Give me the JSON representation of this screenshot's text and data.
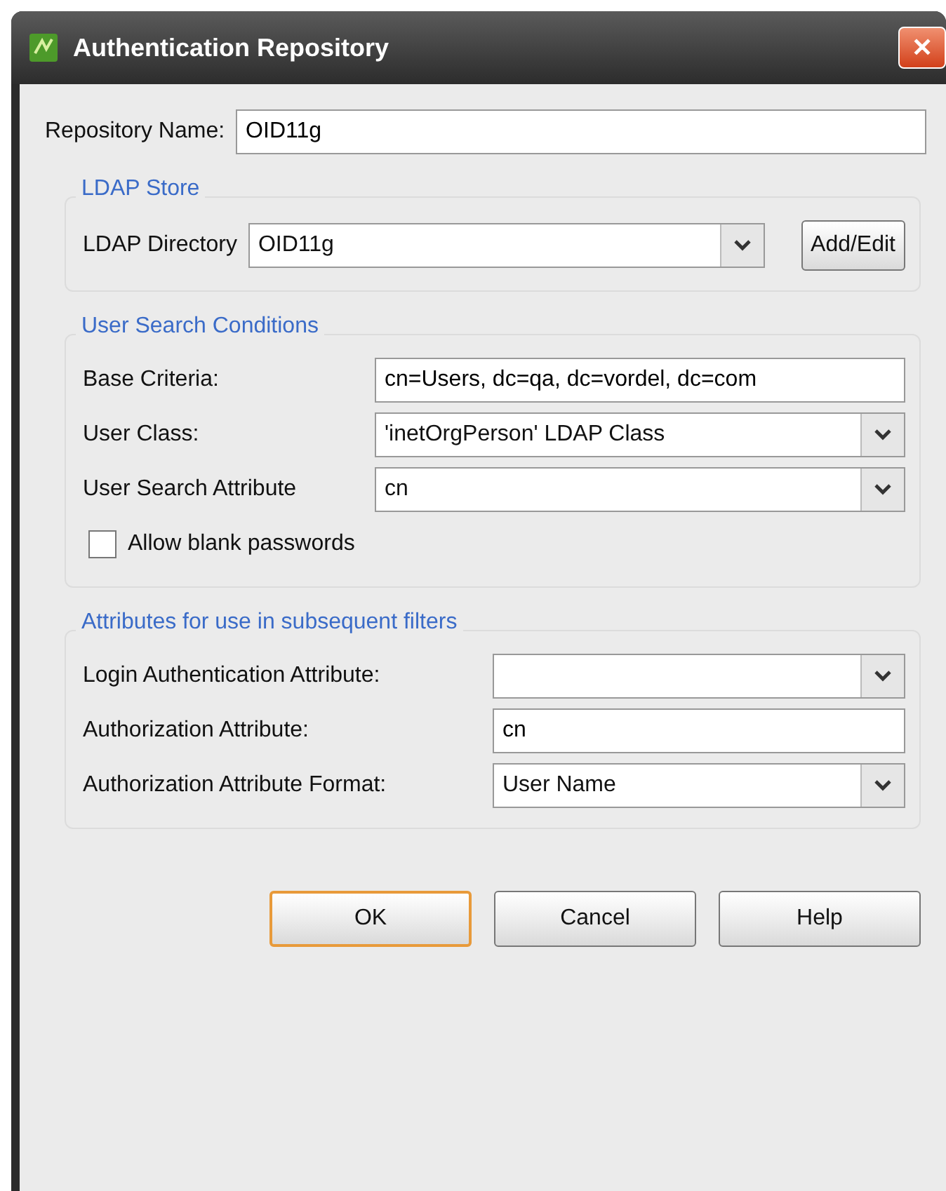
{
  "window": {
    "title": "Authentication Repository",
    "close": "✕"
  },
  "repository_name": {
    "label": "Repository Name:",
    "value": "OID11g"
  },
  "groups": [
    {
      "title": "LDAP Store",
      "rows": [
        {
          "kind": "combo_button",
          "label": "LDAP Directory",
          "value": "OID11g",
          "button": "Add/Edit"
        }
      ]
    },
    {
      "title": "User Search Conditions",
      "rows": [
        {
          "kind": "text",
          "label": "Base Criteria:",
          "value": "cn=Users, dc=qa, dc=vordel, dc=com"
        },
        {
          "kind": "combo",
          "label": "User Class:",
          "value": "'inetOrgPerson' LDAP Class"
        },
        {
          "kind": "combo",
          "label": "User Search Attribute",
          "value": "cn"
        },
        {
          "kind": "checkbox",
          "label": "Allow blank passwords",
          "checked": false
        }
      ]
    },
    {
      "title": "Attributes for use in subsequent filters",
      "rows": [
        {
          "kind": "combo",
          "label": "Login Authentication Attribute:",
          "value": ""
        },
        {
          "kind": "text",
          "label": "Authorization Attribute:",
          "value": "cn"
        },
        {
          "kind": "combo",
          "label": "Authorization Attribute Format:",
          "value": "User Name"
        }
      ]
    }
  ],
  "buttons": [
    {
      "label": "OK",
      "default": true
    },
    {
      "label": "Cancel",
      "default": false
    },
    {
      "label": "Help",
      "default": false
    }
  ]
}
